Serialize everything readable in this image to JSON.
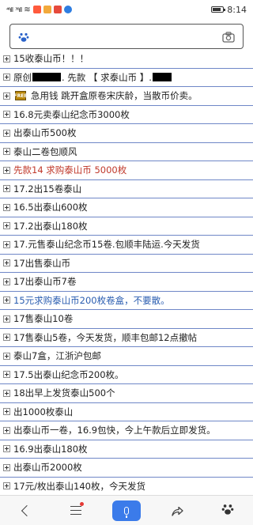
{
  "status_bar": {
    "signal_1": "⁴⁶ıll",
    "signal_2": "³⁶ıll",
    "time": "8:14",
    "battery_level": 0.85,
    "app_icon_colors": [
      "#ff5a3c",
      "#f2a93b",
      "#e64a3c",
      "#2e7de1"
    ]
  },
  "search": {
    "value": "",
    "placeholder": ""
  },
  "posts": [
    {
      "text": "15收泰山币！！！",
      "style": "normal"
    },
    {
      "text_before": "原创",
      "text_middle": ". 先款 【 求泰山币 】.",
      "style": "redacted"
    },
    {
      "thumb_label": "FREE",
      "text": "急用钱 跳开盒原卷宋庆龄，当散币价卖。",
      "style": "thumb"
    },
    {
      "text": "16.8元卖泰山纪念币3000枚",
      "style": "normal"
    },
    {
      "text": "出泰山币500枚",
      "style": "normal"
    },
    {
      "text": "泰山二卷包顺风",
      "style": "normal"
    },
    {
      "text": "先款14 求购泰山币 5000枚",
      "style": "red"
    },
    {
      "text": "17.2出15卷泰山",
      "style": "normal"
    },
    {
      "text": "16.5出泰山600枚",
      "style": "normal"
    },
    {
      "text": "17.2出泰山180枚",
      "style": "normal"
    },
    {
      "text": "17.元售泰山纪念币15卷.包顺丰陆运.今天发货",
      "style": "normal"
    },
    {
      "text": "17出售泰山币",
      "style": "normal"
    },
    {
      "text": "17出泰山币7卷",
      "style": "normal"
    },
    {
      "text": "15元求购泰山币200枚卷盒，不要散。",
      "style": "blue"
    },
    {
      "text": "17售泰山10卷",
      "style": "normal"
    },
    {
      "text": "17售泰山5卷，今天发货，顺丰包邮12点撤帖",
      "style": "normal"
    },
    {
      "text": "泰山7盒，江浙沪包邮",
      "style": "normal"
    },
    {
      "text": "17.5出泰山纪念币200枚。",
      "style": "normal"
    },
    {
      "text": "18出早上发货泰山500个",
      "style": "normal"
    },
    {
      "text": "出1000枚泰山",
      "style": "normal"
    },
    {
      "text": "出泰山币一卷，16.9包快，今上午款后立即发货。",
      "style": "normal"
    },
    {
      "text": "16.9出泰山180枚",
      "style": "normal"
    },
    {
      "text": "出泰山币2000枚",
      "style": "normal"
    },
    {
      "text": "17元/枚出泰山140枚，今天发货",
      "style": "normal"
    }
  ],
  "colors": {
    "row_divider": "#6f87c7",
    "red_text": "#c0392b",
    "blue_text": "#2a5db0",
    "mic_button": "#3b7bea"
  },
  "bottom_nav": {
    "items": [
      "back-icon",
      "menu-icon",
      "mic-icon",
      "share-icon",
      "paw-icon"
    ]
  }
}
